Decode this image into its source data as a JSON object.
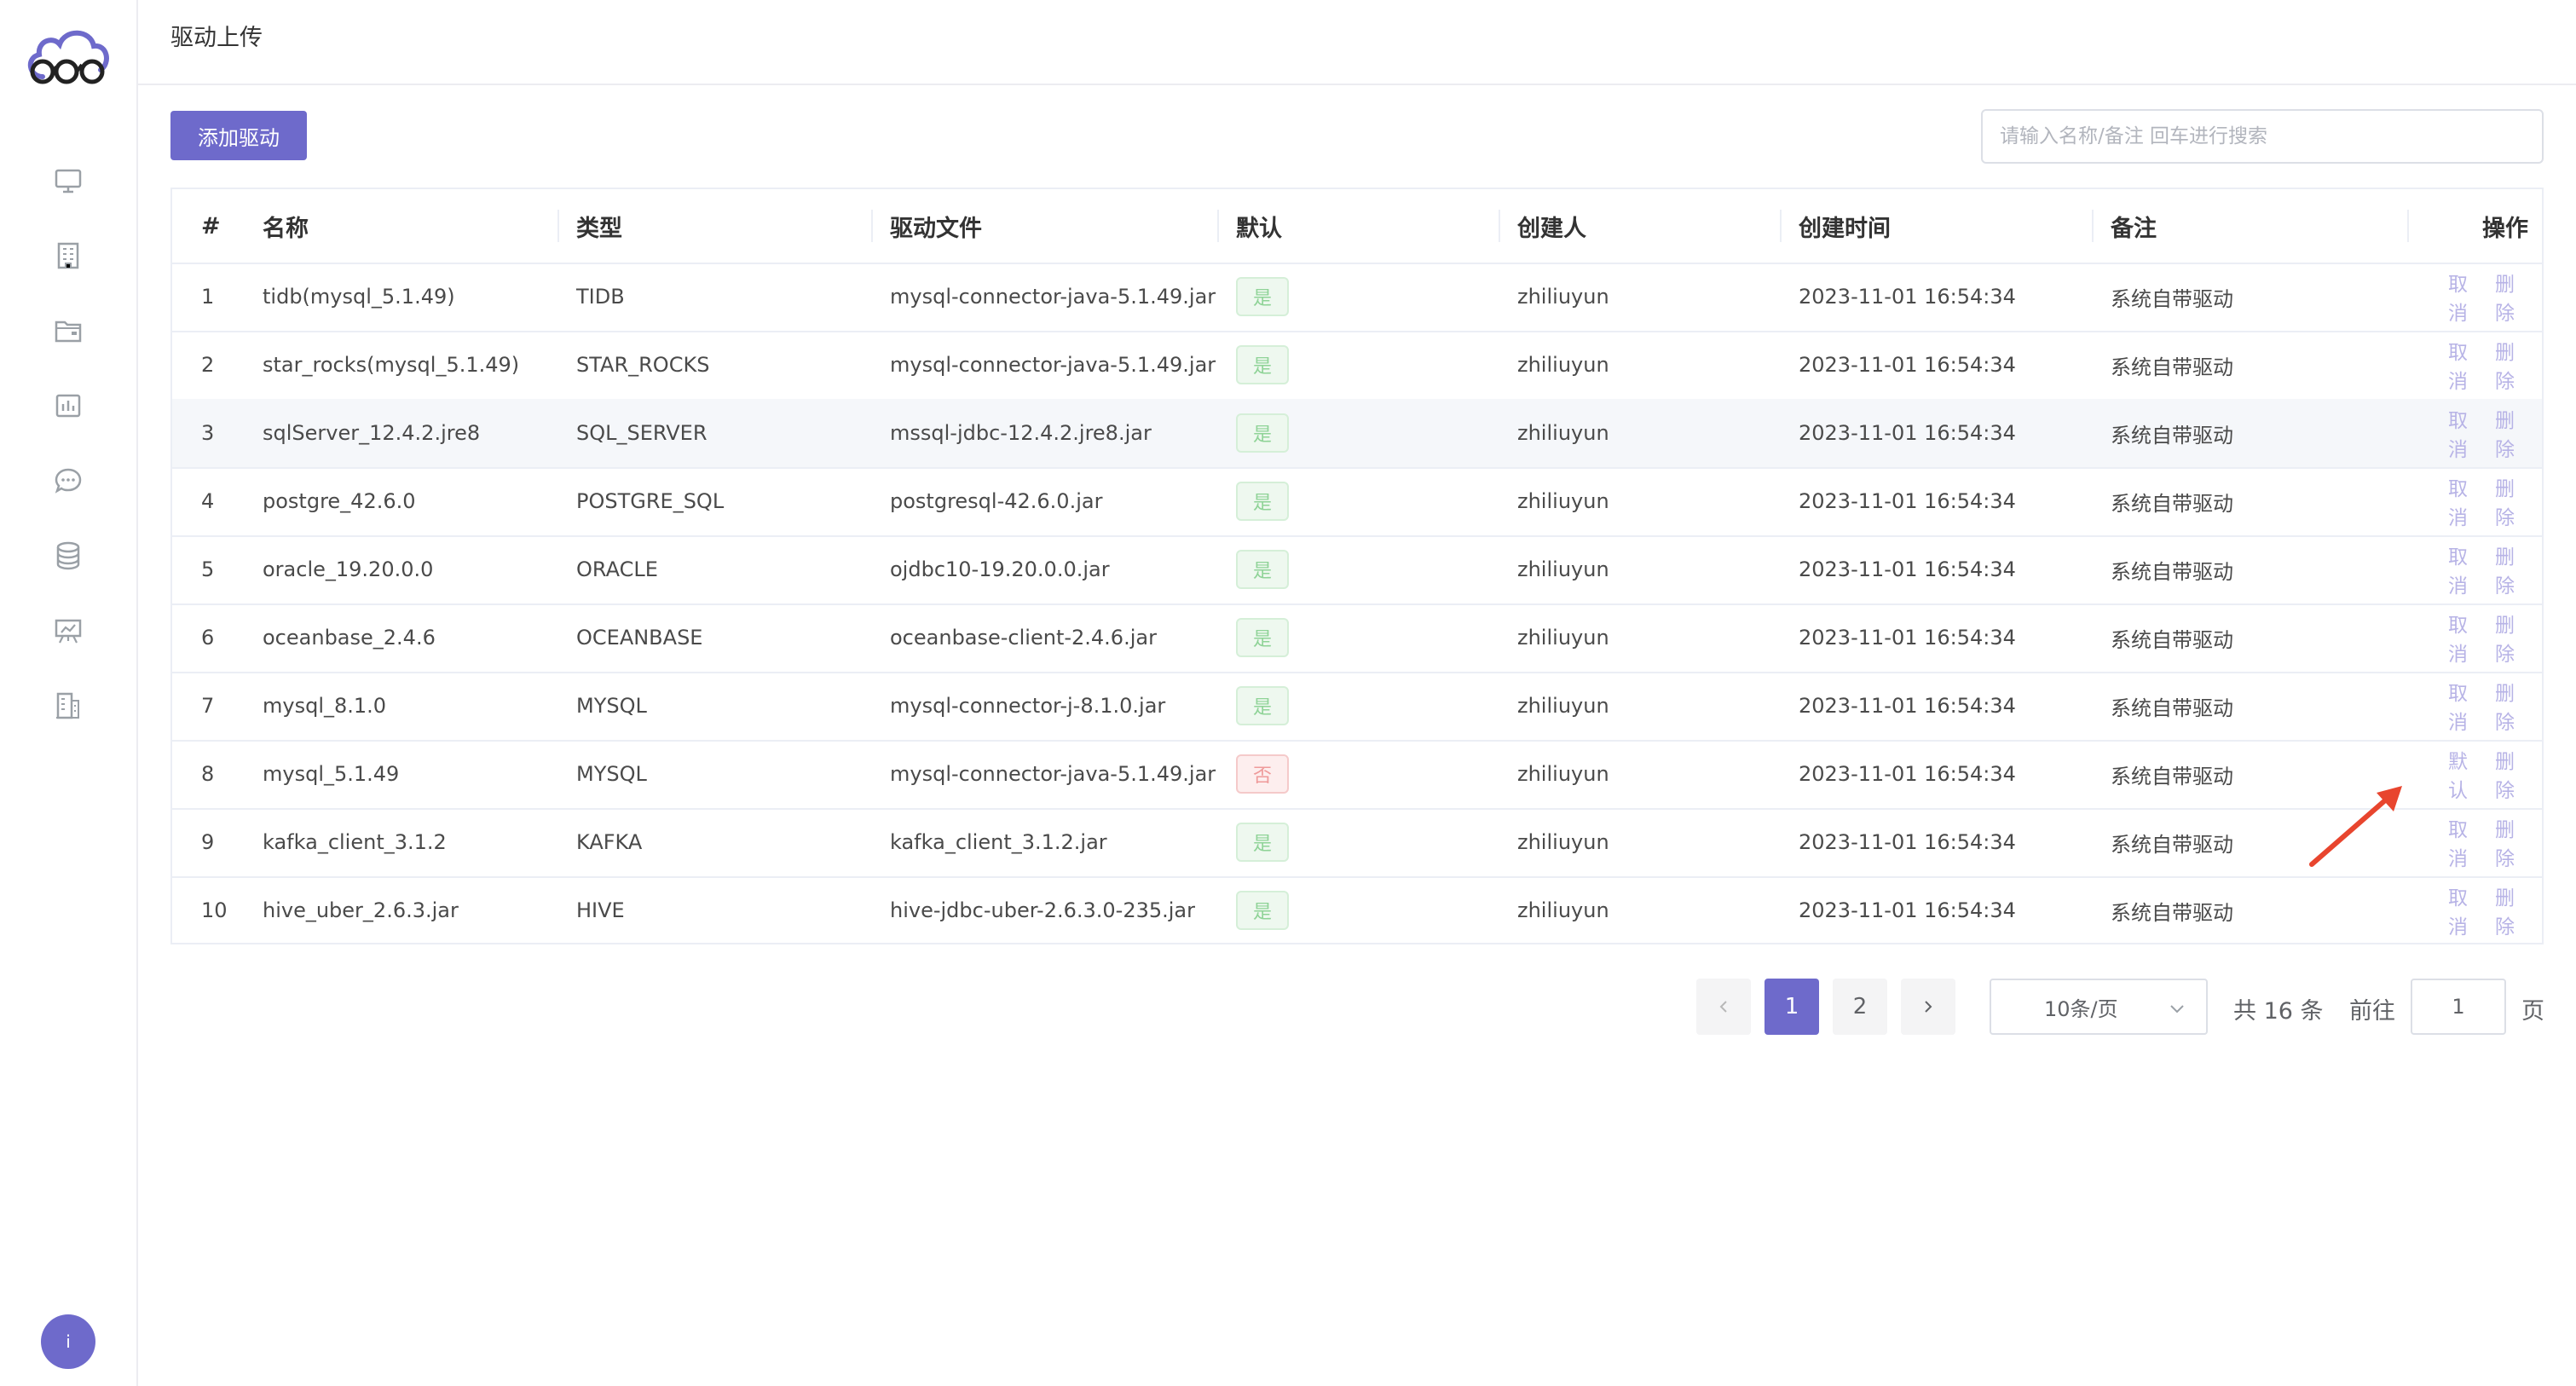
{
  "header": {
    "title": "驱动上传"
  },
  "toolbar": {
    "add_label": "添加驱动",
    "search_placeholder": "请输入名称/备注 回车进行搜索"
  },
  "sidebar": {
    "icons": [
      "monitor-icon",
      "building-icon",
      "folder-icon",
      "chart-icon",
      "chat-icon",
      "database-icon",
      "presentation-icon",
      "office-icon"
    ],
    "avatar_label": "i"
  },
  "table": {
    "columns": [
      "#",
      "名称",
      "类型",
      "驱动文件",
      "默认",
      "创建人",
      "创建时间",
      "备注",
      "操作"
    ],
    "rows": [
      {
        "idx": "1",
        "name": "tidb(mysql_5.1.49)",
        "type": "TIDB",
        "file": "mysql-connector-java-5.1.49.jar",
        "default": "是",
        "creator": "zhiliuyun",
        "time": "2023-11-01 16:54:34",
        "note": "系统自带驱动",
        "action1": "取消",
        "action2": "删除"
      },
      {
        "idx": "2",
        "name": "star_rocks(mysql_5.1.49)",
        "type": "STAR_ROCKS",
        "file": "mysql-connector-java-5.1.49.jar",
        "default": "是",
        "creator": "zhiliuyun",
        "time": "2023-11-01 16:54:34",
        "note": "系统自带驱动",
        "action1": "取消",
        "action2": "删除"
      },
      {
        "idx": "3",
        "name": "sqlServer_12.4.2.jre8",
        "type": "SQL_SERVER",
        "file": "mssql-jdbc-12.4.2.jre8.jar",
        "default": "是",
        "creator": "zhiliuyun",
        "time": "2023-11-01 16:54:34",
        "note": "系统自带驱动",
        "action1": "取消",
        "action2": "删除"
      },
      {
        "idx": "4",
        "name": "postgre_42.6.0",
        "type": "POSTGRE_SQL",
        "file": "postgresql-42.6.0.jar",
        "default": "是",
        "creator": "zhiliuyun",
        "time": "2023-11-01 16:54:34",
        "note": "系统自带驱动",
        "action1": "取消",
        "action2": "删除"
      },
      {
        "idx": "5",
        "name": "oracle_19.20.0.0",
        "type": "ORACLE",
        "file": "ojdbc10-19.20.0.0.jar",
        "default": "是",
        "creator": "zhiliuyun",
        "time": "2023-11-01 16:54:34",
        "note": "系统自带驱动",
        "action1": "取消",
        "action2": "删除"
      },
      {
        "idx": "6",
        "name": "oceanbase_2.4.6",
        "type": "OCEANBASE",
        "file": "oceanbase-client-2.4.6.jar",
        "default": "是",
        "creator": "zhiliuyun",
        "time": "2023-11-01 16:54:34",
        "note": "系统自带驱动",
        "action1": "取消",
        "action2": "删除"
      },
      {
        "idx": "7",
        "name": "mysql_8.1.0",
        "type": "MYSQL",
        "file": "mysql-connector-j-8.1.0.jar",
        "default": "是",
        "creator": "zhiliuyun",
        "time": "2023-11-01 16:54:34",
        "note": "系统自带驱动",
        "action1": "取消",
        "action2": "删除"
      },
      {
        "idx": "8",
        "name": "mysql_5.1.49",
        "type": "MYSQL",
        "file": "mysql-connector-java-5.1.49.jar",
        "default": "否",
        "creator": "zhiliuyun",
        "time": "2023-11-01 16:54:34",
        "note": "系统自带驱动",
        "action1": "默认",
        "action2": "删除"
      },
      {
        "idx": "9",
        "name": "kafka_client_3.1.2",
        "type": "KAFKA",
        "file": "kafka_client_3.1.2.jar",
        "default": "是",
        "creator": "zhiliuyun",
        "time": "2023-11-01 16:54:34",
        "note": "系统自带驱动",
        "action1": "取消",
        "action2": "删除"
      },
      {
        "idx": "10",
        "name": "hive_uber_2.6.3.jar",
        "type": "HIVE",
        "file": "hive-jdbc-uber-2.6.3.0-235.jar",
        "default": "是",
        "creator": "zhiliuyun",
        "time": "2023-11-01 16:54:34",
        "note": "系统自带驱动",
        "action1": "取消",
        "action2": "删除"
      }
    ]
  },
  "pagination": {
    "pages": [
      "1",
      "2"
    ],
    "active_page": "1",
    "page_size": "10条/页",
    "total": "共 16 条",
    "goto_label": "前往",
    "goto_value": "1",
    "page_suffix": "页"
  },
  "colors": {
    "accent": "#6e6acb",
    "yes": "#8fd397",
    "no": "#ef9a9a",
    "annotation": "#e8452e"
  }
}
